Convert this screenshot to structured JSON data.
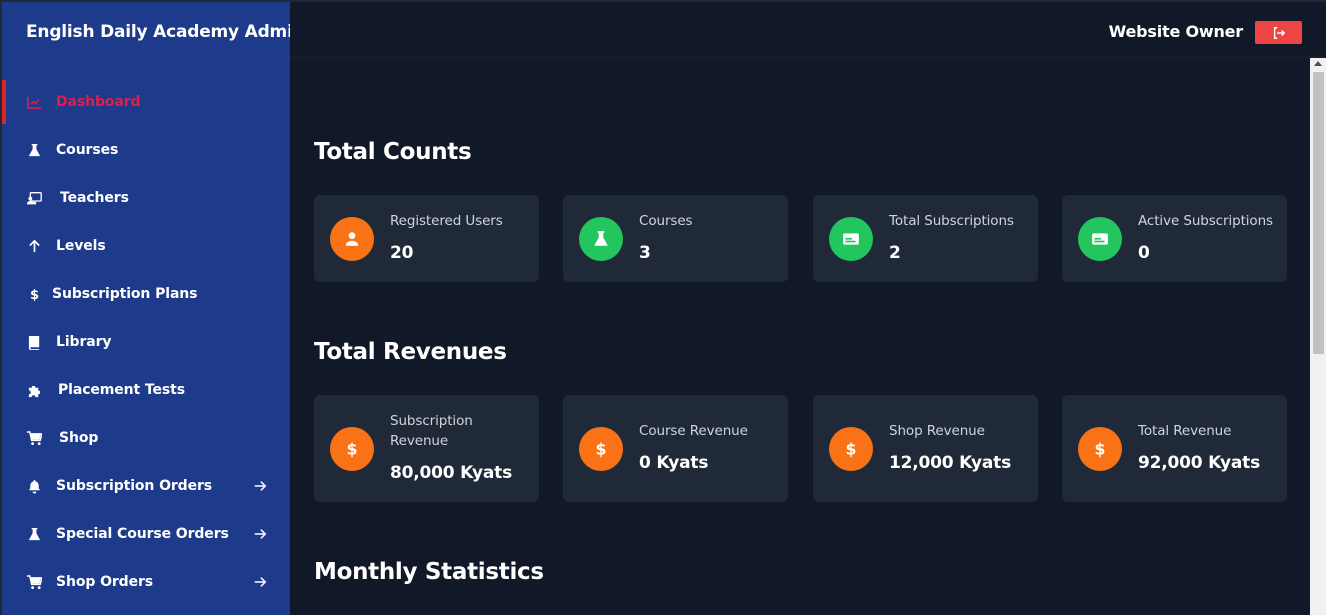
{
  "sidebar": {
    "title": "English Daily Academy Admin",
    "items": [
      {
        "label": "Dashboard",
        "icon": "chart-line-icon",
        "active": true
      },
      {
        "label": "Courses",
        "icon": "flask-icon"
      },
      {
        "label": "Teachers",
        "icon": "chalkboard-teacher-icon"
      },
      {
        "label": "Levels",
        "icon": "arrow-up-icon"
      },
      {
        "label": "Subscription Plans",
        "icon": "dollar-icon"
      },
      {
        "label": "Library",
        "icon": "book-icon"
      },
      {
        "label": "Placement Tests",
        "icon": "puzzle-icon"
      },
      {
        "label": "Shop",
        "icon": "cart-icon"
      },
      {
        "label": "Subscription Orders",
        "icon": "bell-icon",
        "arrow": true
      },
      {
        "label": "Special Course Orders",
        "icon": "flask-icon",
        "arrow": true
      },
      {
        "label": "Shop Orders",
        "icon": "cart-icon",
        "arrow": true
      }
    ]
  },
  "topbar": {
    "owner": "Website Owner",
    "logout_icon": "sign-out-icon"
  },
  "sections": {
    "counts_title": "Total Counts",
    "revenues_title": "Total Revenues",
    "monthly_title": "Monthly Statistics"
  },
  "counts": [
    {
      "label": "Registered Users",
      "value": "20",
      "icon": "user-icon",
      "color": "#f97316"
    },
    {
      "label": "Courses",
      "value": "3",
      "icon": "flask-icon",
      "color": "#22c55e"
    },
    {
      "label": "Total Subscriptions",
      "value": "2",
      "icon": "id-card-icon",
      "color": "#22c55e"
    },
    {
      "label": "Active Subscriptions",
      "value": "0",
      "icon": "id-card-icon",
      "color": "#22c55e"
    }
  ],
  "revenues": [
    {
      "label": "Subscription Revenue",
      "value": "80,000 Kyats",
      "icon": "dollar-icon",
      "color": "#f97316"
    },
    {
      "label": "Course Revenue",
      "value": "0 Kyats",
      "icon": "dollar-icon",
      "color": "#f97316"
    },
    {
      "label": "Shop Revenue",
      "value": "12,000 Kyats",
      "icon": "dollar-icon",
      "color": "#f97316"
    },
    {
      "label": "Total Revenue",
      "value": "92,000 Kyats",
      "icon": "dollar-icon",
      "color": "#f97316"
    }
  ],
  "colors": {
    "sidebar_bg": "#1e3a8a",
    "page_bg": "#111827",
    "card_bg": "#1f2937",
    "active": "#e11d48",
    "orange": "#f97316",
    "green": "#22c55e",
    "logout": "#ef4444"
  }
}
